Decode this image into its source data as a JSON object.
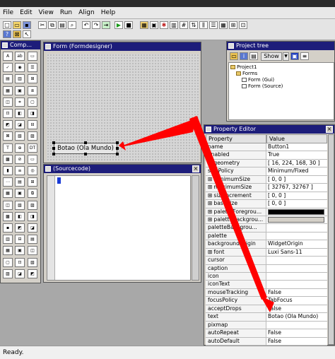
{
  "menubar": {
    "items": [
      "File",
      "Edit",
      "View",
      "Run",
      "Align",
      "Help"
    ]
  },
  "toolbar": {
    "buttons": [
      "new-icon",
      "open-icon",
      "save-icon",
      "cut-icon",
      "copy-icon",
      "paste-icon",
      "find-icon",
      "run-icon",
      "stop-icon",
      "form-icon",
      "debug-icon",
      "component-icon",
      "grid-icon"
    ]
  },
  "components": {
    "title": "Comp..."
  },
  "form": {
    "title": "Form (Formdesigner)",
    "button_text": "Botao (Ola Mundo)"
  },
  "source": {
    "title": "(Sourcecode)"
  },
  "ptree": {
    "title": "Project tree",
    "show_label": "Show",
    "items": [
      "Project1",
      "Forms",
      "Form (Gui)",
      "Form (Source)"
    ]
  },
  "pedit": {
    "title": "Property Editor",
    "col_property": "Property",
    "col_value": "Value",
    "rows": [
      {
        "name": "name",
        "value": "Button1",
        "exp": false
      },
      {
        "name": "enabled",
        "value": "True",
        "exp": false
      },
      {
        "name": "geometry",
        "value": "[ 16, 224, 168, 30 ]",
        "exp": true
      },
      {
        "name": "sizePolicy",
        "value": "Minimum/Fixed",
        "exp": false
      },
      {
        "name": "minimumSize",
        "value": "[ 0, 0 ]",
        "exp": true
      },
      {
        "name": "maximumSize",
        "value": "[ 32767, 32767 ]",
        "exp": true
      },
      {
        "name": "sizeIncrement",
        "value": "[ 0, 0 ]",
        "exp": true
      },
      {
        "name": "baseSize",
        "value": "[ 0, 0 ]",
        "exp": true
      },
      {
        "name": "paletteForegrou...",
        "value": "",
        "exp": true,
        "swatch": "#000000"
      },
      {
        "name": "paletteBackgrou...",
        "value": "",
        "exp": true,
        "swatch": "#d4d0c8"
      },
      {
        "name": "paletteBackgrou...",
        "value": "",
        "exp": false
      },
      {
        "name": "palette",
        "value": "",
        "exp": false
      },
      {
        "name": "backgroundOrigin",
        "value": "WidgetOrigin",
        "exp": false
      },
      {
        "name": "font",
        "value": "Luxi Sans-11",
        "exp": true
      },
      {
        "name": "cursor",
        "value": "",
        "exp": false
      },
      {
        "name": "caption",
        "value": "",
        "exp": false
      },
      {
        "name": "icon",
        "value": "",
        "exp": false
      },
      {
        "name": "iconText",
        "value": "",
        "exp": false
      },
      {
        "name": "mouseTracking",
        "value": "False",
        "exp": false
      },
      {
        "name": "focusPolicy",
        "value": "TabFocus",
        "exp": false
      },
      {
        "name": "acceptDrops",
        "value": "False",
        "exp": false
      },
      {
        "name": "text",
        "value": "Botao (Ola Mundo)",
        "exp": false
      },
      {
        "name": "pixmap",
        "value": "",
        "exp": false
      },
      {
        "name": "autoRepeat",
        "value": "False",
        "exp": false
      },
      {
        "name": "autoDefault",
        "value": "False",
        "exp": false
      }
    ]
  },
  "status": {
    "text": "Ready."
  },
  "colors": {
    "titlebar": "#1d1d7a",
    "arrow": "#ff0000"
  }
}
